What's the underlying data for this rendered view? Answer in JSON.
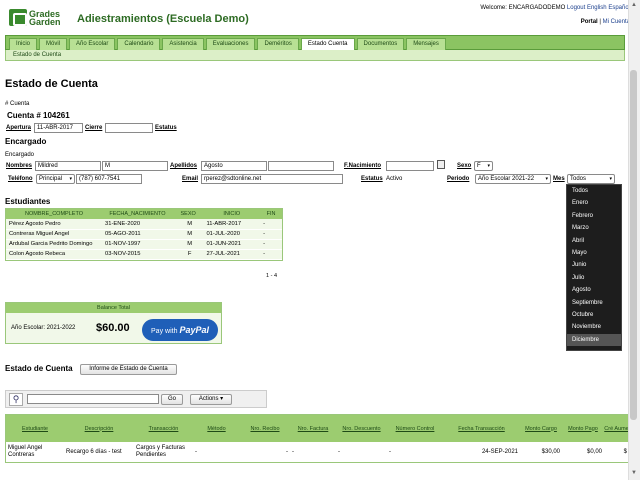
{
  "brand": {
    "logo_line1": "Grades",
    "logo_line2": "Garden",
    "school": "Adiestramientos (Escuela Demo)"
  },
  "header": {
    "welcome": "Welcome: ENCARGADODEMO",
    "logout": "Logout",
    "lang_en": "English",
    "lang_es": "Español",
    "portal": "Portal",
    "sep": "|",
    "mi_cuenta": "Mi Cuenta"
  },
  "nav": {
    "items": [
      "Inicio",
      "Móvil",
      "Año Escolar",
      "Calendario",
      "Asistencia",
      "Evaluaciones",
      "Deméritos",
      "Estado Cuenta",
      "Documentos",
      "Mensajes"
    ],
    "active": "Estado Cuenta",
    "sub": "Estado de Cuenta"
  },
  "page": {
    "title": "Estado de Cuenta"
  },
  "cuenta": {
    "hash_label": "# Cuenta",
    "heading": "Cuenta # 104261",
    "apertura_label": "Apertura",
    "apertura_value": "11-ABR-2017",
    "cierre_label": "Cierre",
    "cierre_value": "",
    "estatus_label": "Estatus"
  },
  "encargado": {
    "heading": "Encargado",
    "sub": "Encargado",
    "nombres_label": "Nombres",
    "nombre1": "Mildred",
    "nombre2": "M",
    "apellidos_label": "Apellidos",
    "apellido1": "Agosto",
    "apellido2": "",
    "fnac_label": "F.Nacimiento",
    "fnac_value": "",
    "sexo_label": "Sexo",
    "sexo_value": "F",
    "telefono_label": "Teléfono",
    "tel_type": "Principal",
    "tel_value": "(787) 607-7541",
    "email_label": "Email",
    "email_value": "rperez@sdtonline.net",
    "estatus_label": "Estatus",
    "estatus_value": "Activo",
    "periodo_label": "Periodo",
    "periodo_value": "Año Escolar 2021-22",
    "mes_label": "Mes",
    "mes_value": "Todos"
  },
  "estudiantes": {
    "heading": "Estudiantes",
    "columns": [
      "NOMBRE_COMPLETO",
      "FECHA_NACIMIENTO",
      "SEXO",
      "INICIO",
      "FIN"
    ],
    "rows": [
      [
        "Pérez Agosto Pedro",
        "31-ENE-2020",
        "M",
        "11-ABR-2017",
        "-"
      ],
      [
        "Contreras Miguel Angel",
        "05-AGO-2011",
        "M",
        "01-JUL-2020",
        "-"
      ],
      [
        "Ardubal Garcia Pedrito Domingo",
        "01-NOV-1997",
        "M",
        "01-JUN-2021",
        "-"
      ],
      [
        "Colon Agosto Rebeca",
        "03-NOV-2015",
        "F",
        "27-JUL-2021",
        "-"
      ]
    ],
    "pager": "1 - 4"
  },
  "balance": {
    "heading": "Balance Total",
    "label": "Año Escolar: 2021-2022",
    "amount": "$60.00",
    "paypal_pre": "Pay with",
    "paypal_brand": "PayPal"
  },
  "estado": {
    "heading": "Estado de Cuenta",
    "informe_button": "Informe de Estado de Cuenta",
    "search_value": "",
    "go_button": "Go",
    "actions_button": "Actions ▾"
  },
  "transacciones": {
    "columns": [
      "Estudiante",
      "Descripción",
      "Transacción",
      "Método",
      "Nro. Recibo",
      "Nro. Factura",
      "Nro. Descuento",
      "Número Control",
      "Fecha Transacción",
      "Monto Cargo",
      "Monto Pago",
      "Cré Aume"
    ],
    "rows": [
      [
        "Miguel Angel Contreras",
        "Recargo 6 días - test",
        "Cargos y Facturas Pendientes",
        "-",
        "-",
        "-",
        "-",
        "-",
        "24-SEP-2021",
        "$30,00",
        "$0,00",
        "$"
      ]
    ]
  },
  "month_dropdown": {
    "options": [
      "Todos",
      "Enero",
      "Febrero",
      "Marzo",
      "Abril",
      "Mayo",
      "Junio",
      "Julio",
      "Agosto",
      "Septiembre",
      "Octubre",
      "Noviembre",
      "Diciembre"
    ],
    "highlighted": "Diciembre"
  },
  "icons": {
    "calendar": "calendar-icon",
    "search": "magnifier-icon",
    "scroll_up": "▲",
    "scroll_down": "▼"
  }
}
